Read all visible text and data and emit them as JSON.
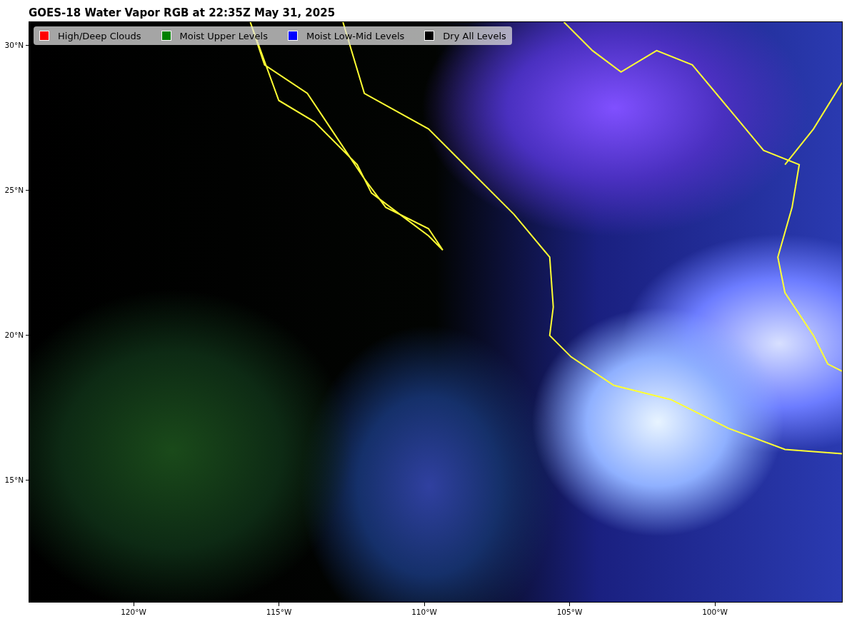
{
  "title": "GOES-18 Water Vapor RGB at 22:35Z May 31, 2025",
  "legend": [
    {
      "label": "High/Deep Clouds",
      "color": "#ff0000"
    },
    {
      "label": "Moist Upper Levels",
      "color": "#008000"
    },
    {
      "label": "Moist Low-Mid Levels",
      "color": "#0000ff"
    },
    {
      "label": "Dry All Levels",
      "color": "#000000"
    }
  ],
  "latitude_ticks": [
    "30°N",
    "25°N",
    "20°N",
    "15°N"
  ],
  "longitude_ticks": [
    "120°W",
    "115°W",
    "110°W",
    "105°W",
    "100°W"
  ]
}
